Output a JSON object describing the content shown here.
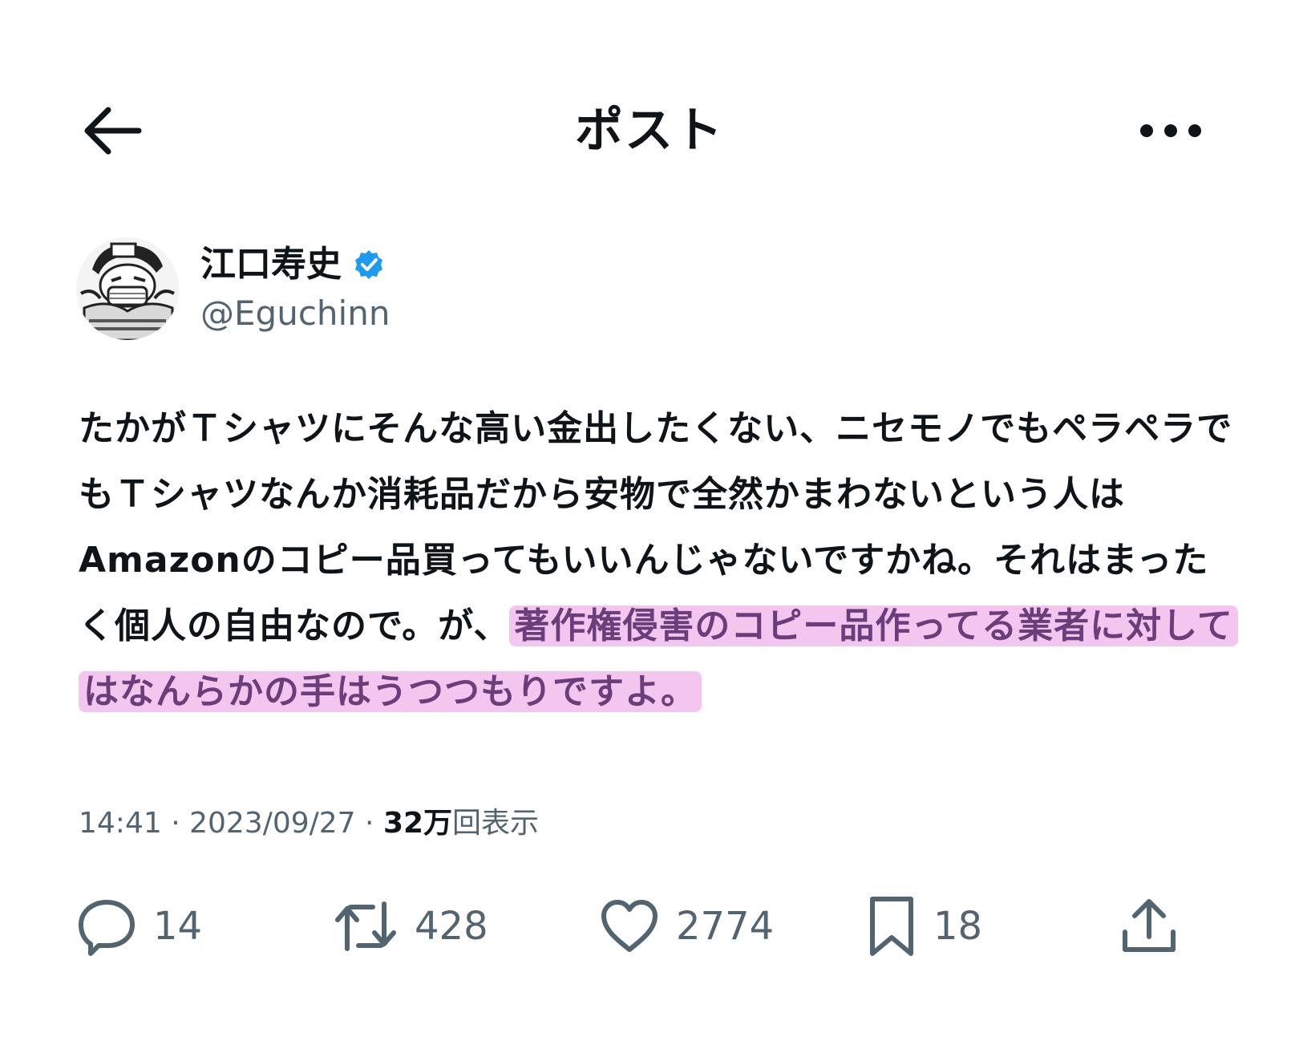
{
  "header": {
    "title": "ポスト",
    "back_icon": "arrow-left-icon",
    "more_icon": "more-horizontal-icon"
  },
  "author": {
    "display_name": "江口寿史",
    "handle": "@Eguchinn",
    "verified": true,
    "verified_color": "#1d9bf0"
  },
  "tweet": {
    "text_plain": "たかがＴシャツにそんな高い金出したくない、ニセモノでもペラペラでもＴシャツなんか消耗品だから安物で全然かまわないという人はAmazonのコピー品買ってもいいんじゃないですかね。それはまったく個人の自由なので。が、",
    "text_highlighted": "著作権侵害のコピー品作ってる業者に対してはなんらかの手はうつつもりですよ。",
    "highlight_color": "#f3c6f0"
  },
  "meta": {
    "time": "14:41",
    "sep1": " · ",
    "date": "2023/09/27",
    "sep2": " · ",
    "views_count": "32万",
    "views_label": "回表示"
  },
  "actions": {
    "replies": "14",
    "reposts": "428",
    "likes": "2774",
    "bookmarks": "18"
  },
  "colors": {
    "text": "#0f1419",
    "secondary": "#536471",
    "background": "#ffffff"
  }
}
